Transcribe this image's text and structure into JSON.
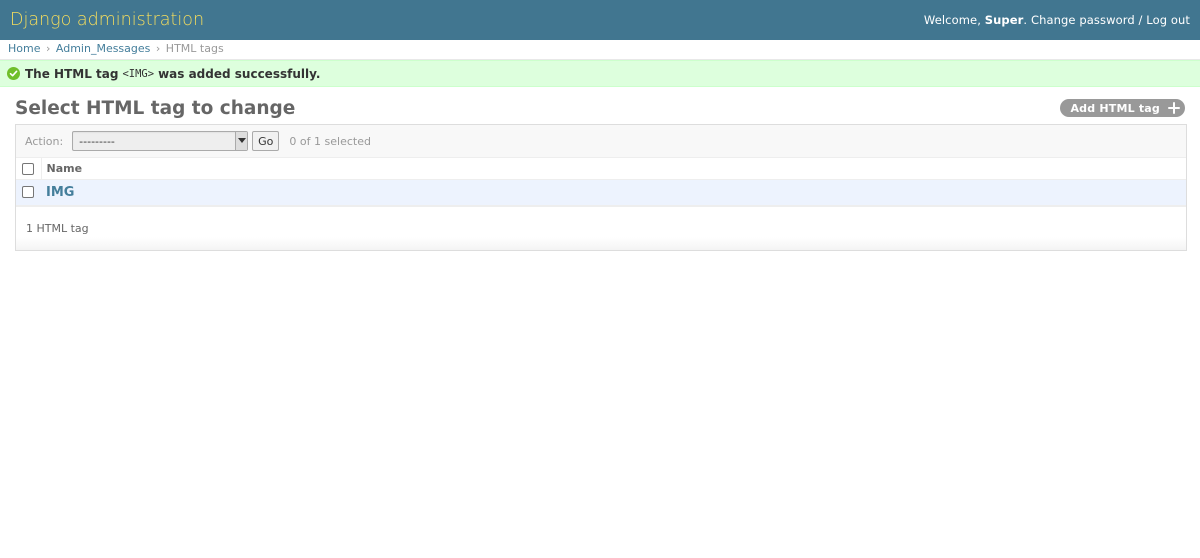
{
  "header": {
    "branding": "Django administration",
    "welcome": "Welcome,",
    "username": "Super",
    "change_password": "Change password",
    "separator": "/",
    "logout": "Log out"
  },
  "breadcrumbs": {
    "home": "Home",
    "app": "Admin_Messages",
    "current": "HTML tags",
    "sep": "›"
  },
  "message": {
    "prefix": "The HTML tag",
    "code": "<IMG>",
    "suffix": "was added successfully.",
    "icon": "check-circle-icon"
  },
  "page": {
    "title": "Select HTML tag to change",
    "add_button": "Add HTML tag"
  },
  "actions": {
    "label": "Action:",
    "selected_option": "---------",
    "go": "Go",
    "counter": "0 of 1 selected"
  },
  "table": {
    "columns": [
      "Name"
    ],
    "rows": [
      {
        "name": "IMG"
      }
    ]
  },
  "paginator": {
    "text": "1 HTML tag"
  },
  "colors": {
    "header_bg": "#417690",
    "branding": "#f5dd5d",
    "link": "#447e9b",
    "success_bg": "#dfd",
    "row_highlight": "#edf3fe"
  }
}
